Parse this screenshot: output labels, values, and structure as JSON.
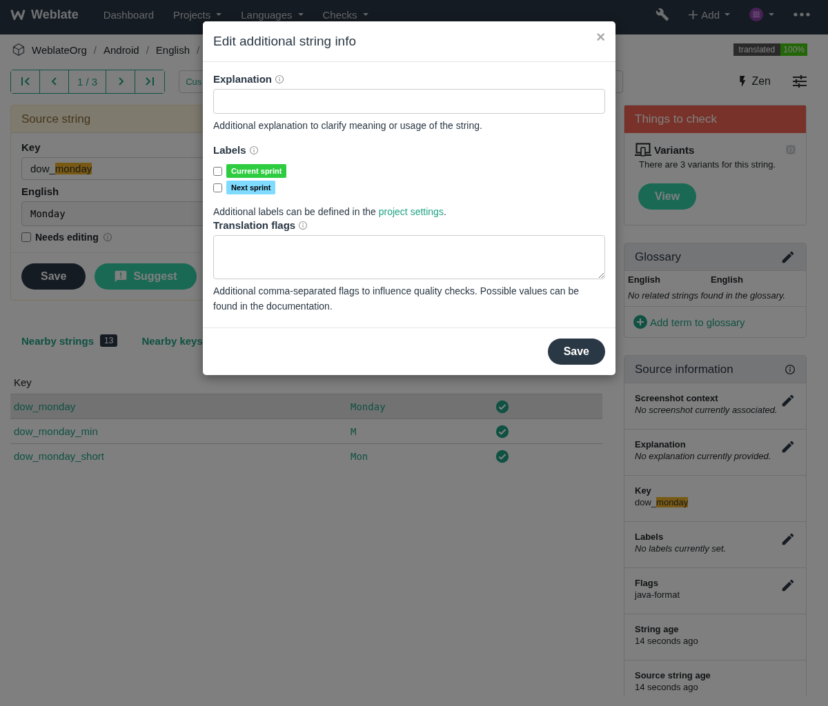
{
  "navbar": {
    "brand": "Weblate",
    "menu": [
      {
        "label": "Dashboard",
        "dropdown": false
      },
      {
        "label": "Projects",
        "dropdown": true
      },
      {
        "label": "Languages",
        "dropdown": true
      },
      {
        "label": "Checks",
        "dropdown": true
      }
    ],
    "add": "Add"
  },
  "breadcrumb": {
    "items": [
      "WeblateOrg",
      "Android",
      "English"
    ],
    "separator": "/"
  },
  "progress_badge": {
    "label": "translated",
    "value": "100%"
  },
  "pager": {
    "position": "1 / 3"
  },
  "search": {
    "value": "Cus"
  },
  "zen": "Zen",
  "source_panel": {
    "title": "Source string",
    "key_label": "Key",
    "key": {
      "text": "dow_",
      "highlight": "monday"
    },
    "english_label": "English",
    "english_value": "Monday",
    "needs_editing": {
      "label": "Needs editing",
      "checked": false
    },
    "save": "Save",
    "suggest": "Suggest"
  },
  "tabs": [
    {
      "label": "Nearby strings",
      "count": "13"
    },
    {
      "label": "Nearby keys"
    }
  ],
  "nearby_table": {
    "columns": [
      "Key"
    ],
    "rows": [
      {
        "key": "dow_monday",
        "source": "Monday",
        "selected": true
      },
      {
        "key": "dow_monday_min",
        "source": "M",
        "selected": false
      },
      {
        "key": "dow_monday_short",
        "source": "Mon",
        "selected": false
      }
    ]
  },
  "things_to_check": {
    "title": "Things to check",
    "checks": [
      {
        "name": "Variants",
        "description": "There are 3 variants for this string.",
        "button": "View"
      }
    ]
  },
  "glossary": {
    "title": "Glossary",
    "columns": [
      "English",
      "English"
    ],
    "empty": "No related strings found in the glossary.",
    "add_link": "Add term to glossary"
  },
  "source_info": {
    "title": "Source information",
    "items": [
      {
        "label": "Screenshot context",
        "value": "No screenshot currently associated.",
        "italic": true,
        "editable": true
      },
      {
        "label": "Explanation",
        "value": "No explanation currently provided.",
        "italic": true,
        "editable": true
      },
      {
        "label": "Key",
        "value": "dow_",
        "highlight": "monday",
        "italic": false,
        "editable": false
      },
      {
        "label": "Labels",
        "value": "No labels currently set.",
        "italic": true,
        "editable": true
      },
      {
        "label": "Flags",
        "value": "java-format",
        "italic": false,
        "editable": true
      },
      {
        "label": "String age",
        "value": "14 seconds ago",
        "italic": false,
        "editable": false
      },
      {
        "label": "Source string age",
        "value": "14 seconds ago",
        "italic": false,
        "editable": false
      }
    ]
  },
  "modal": {
    "title": "Edit additional string info",
    "close": "×",
    "explanation": {
      "label": "Explanation",
      "help": "Additional explanation to clarify meaning or usage of the string."
    },
    "labels": {
      "label": "Labels",
      "items": [
        {
          "name": "Current sprint",
          "color": "#2ecc40",
          "checked": false
        },
        {
          "name": "Next sprint",
          "color": "#7fdbff",
          "checked": false
        }
      ],
      "help_before": "Additional labels can be defined in the ",
      "help_link": "project settings",
      "help_after": "."
    },
    "flags": {
      "label": "Translation flags",
      "help": "Additional comma-separated flags to influence quality checks. Possible values can be found in the documentation."
    },
    "save": "Save"
  }
}
